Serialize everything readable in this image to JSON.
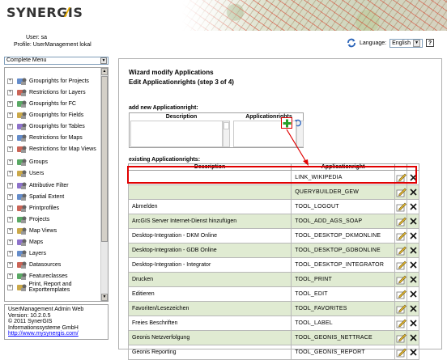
{
  "app": {
    "logo_text": "SYNERGIS",
    "colors": {
      "logo_mark": "#f0b400",
      "highlight": "#e00000",
      "row_alt": "#e0ebd2",
      "add_green": "#2aa02a"
    }
  },
  "user": {
    "user_line": "User: sa",
    "profile_line": "Profile: UserManagement lokal"
  },
  "toolbar": {
    "language_label": "Language:",
    "language_value": "English",
    "help_label": "?",
    "refresh_icon": "refresh-icon"
  },
  "sidebar": {
    "menu_select": "Complete Menu",
    "items": [
      {
        "label": "Grouprights for Projects",
        "icon": "grouprights-icon"
      },
      {
        "label": "Restrictions for Layers",
        "icon": "restriction-icon"
      },
      {
        "label": "Grouprights for FC",
        "icon": "grouprights-icon"
      },
      {
        "label": "Grouprights for Fields",
        "icon": "grouprights-icon"
      },
      {
        "label": "Grouprights for Tables",
        "icon": "grouprights-icon"
      },
      {
        "label": "Restrictions for Maps",
        "icon": "restriction-icon"
      },
      {
        "label": "Restrictions for Map Views",
        "icon": "restriction-icon"
      },
      {
        "label": "Groups",
        "icon": "groups-icon"
      },
      {
        "label": "Users",
        "icon": "users-icon"
      },
      {
        "label": "Attributive Filter",
        "icon": "filter-icon"
      },
      {
        "label": "Spatial Extent",
        "icon": "spatial-extent-icon"
      },
      {
        "label": "Printprofiles",
        "icon": "printer-icon"
      },
      {
        "label": "Projects",
        "icon": "projects-icon"
      },
      {
        "label": "Map Views",
        "icon": "map-views-icon"
      },
      {
        "label": "Maps",
        "icon": "maps-icon"
      },
      {
        "label": "Layers",
        "icon": "layers-icon"
      },
      {
        "label": "Datasources",
        "icon": "datasources-icon"
      },
      {
        "label": "Featureclasses",
        "icon": "featureclasses-icon"
      },
      {
        "label": "Print, Report and Exporttemplates",
        "icon": "print-report-icon"
      }
    ],
    "footer": {
      "line1": "UserManagement Admin Web",
      "line2": "Version: 10.2.0.5",
      "line3": "© 2011 SynerGIS",
      "line4": "Informationssysteme GmbH",
      "link": "http://www.mysynergis.com/"
    }
  },
  "wizard": {
    "title": "Wizard modify Applications",
    "subtitle": "Edit Applicationrights (step 3 of 4)",
    "add_section_label": "add new Applicationright:",
    "add_col_description": "Description",
    "add_col_right": "Applicationrights",
    "existing_section_label": "existing Applicationrights:",
    "col_description": "Description",
    "col_right": "Applicationright",
    "rows": [
      {
        "description": "",
        "right": "LINK_WIKIPEDIA"
      },
      {
        "description": "",
        "right": "QUERYBUILDER_GEW"
      },
      {
        "description": "Abmelden",
        "right": "TOOL_LOGOUT"
      },
      {
        "description": "ArcGIS Server Internet-Dienst hinzufügen",
        "right": "TOOL_ADD_AGS_SOAP"
      },
      {
        "description": "Desktop-Integration - DKM Online",
        "right": "TOOL_DESKTOP_DKMONLINE"
      },
      {
        "description": "Desktop-Integration - GDB Online",
        "right": "TOOL_DESKTOP_GDBONLINE"
      },
      {
        "description": "Desktop-Integration - Integrator",
        "right": "TOOL_DESKTOP_INTEGRATOR"
      },
      {
        "description": "Drucken",
        "right": "TOOL_PRINT"
      },
      {
        "description": "Editieren",
        "right": "TOOL_EDIT"
      },
      {
        "description": "Favoriten/Lesezeichen",
        "right": "TOOL_FAVORITES"
      },
      {
        "description": "Freies Beschriften",
        "right": "TOOL_LABEL"
      },
      {
        "description": "Geonis Netzverfolgung",
        "right": "TOOL_GEONIS_NETTRACE"
      },
      {
        "description": "Geonis Reporting",
        "right": "TOOL_GEONIS_REPORT"
      }
    ]
  }
}
